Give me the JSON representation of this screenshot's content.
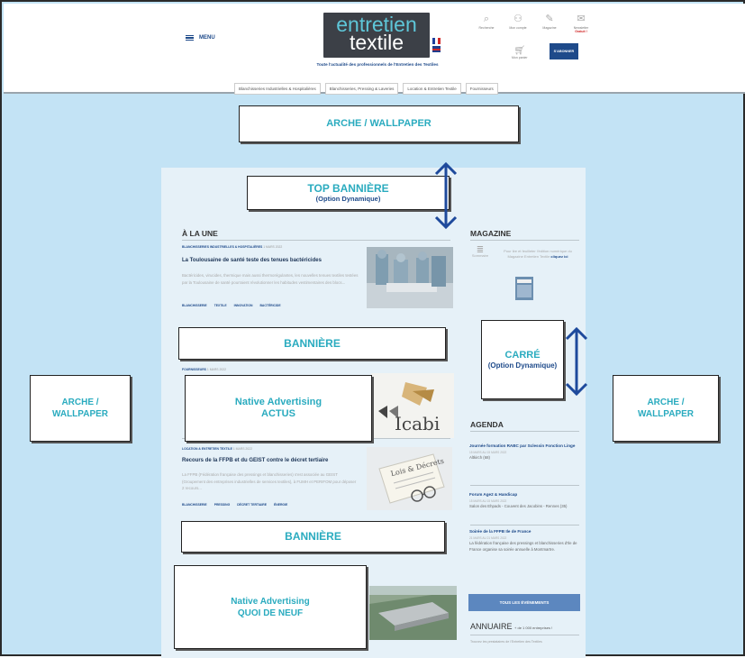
{
  "header": {
    "menu_label": "MENU",
    "logo_line1": "entretien",
    "logo_line2": "textile",
    "tagline": "Toute l'actualité des professionnels de l'Entretien des Textiles",
    "icons": [
      {
        "label": "Recherche",
        "icon": "search-icon"
      },
      {
        "label": "Mon compte",
        "icon": "user-icon"
      },
      {
        "label": "Magazine",
        "icon": "magazine-icon"
      },
      {
        "label": "Newsletter",
        "icon": "newsletter-icon",
        "note": "Gratuit !"
      }
    ],
    "cart_label": "Mon panier",
    "subscribe_label": "S'ABONNER",
    "categories": [
      "Blanchisseries Industrielles & Hospitalières",
      "Blanchisseries, Pressing & Laveries",
      "Location & Entretien Textile",
      "Fournisseurs"
    ]
  },
  "labels": {
    "arche_top": "ARCHE / WALLPAPER",
    "top_banner": "TOP BANNIÈRE",
    "top_banner_sub": "(Option Dynamique)",
    "banner_1": "BANNIÈRE",
    "banner_2": "BANNIÈRE",
    "carre": "CARRÉ",
    "carre_sub": "(Option Dynamique)",
    "native_actus_1": "Native Advertising",
    "native_actus_2": "ACTUS",
    "native_quoi_1": "Native Advertising",
    "native_quoi_2": "QUOI DE NEUF",
    "arche_left": "ARCHE / WALLPAPER",
    "arche_right": "ARCHE / WALLPAPER"
  },
  "main": {
    "une_title": "À LA UNE",
    "article1": {
      "category": "BLANCHISSERIES INDUSTRIELLES & HOSPITALIÈRES",
      "date": "1 MARS 2022",
      "title": "La Toulousaine de santé teste des tenues bactéricides",
      "excerpt": "Bactéricides, virucides, thermique mais aussi thermorégulantes, les nouvelles tenues textiles testées par la Toulousaine de santé pourraient révolutionner les habitudes vestimentaires des blocs...",
      "tags": [
        "BLANCHISSERIE",
        "TEXTILE",
        "INNOVATION",
        "BACTÉRICIDE"
      ]
    },
    "article2": {
      "category": "FOURNISSEURS",
      "date": "1 MARS 2022"
    },
    "article3": {
      "category": "LOCATION & ENTRETIEN TEXTILE",
      "date": "1 MARS 2022",
      "title": "Recours de la FFPB et du GEIST contre le décret tertiaire",
      "excerpt": "La FFPB (Fédération française des pressings et blanchisseries) s'est associée au GEIST (Groupement des entreprises industrielles de services textiles), à FUMH et PERIFOM pour déposer 2 recours...",
      "tags": [
        "BLANCHISSERIE",
        "PRESSING",
        "DÉCRET TERTIAIRE",
        "ÉNERGIE"
      ],
      "image_text": "Lois & Décrets"
    },
    "logo_text": "Icabi"
  },
  "sidebar": {
    "magazine_title": "MAGAZINE",
    "magazine_summary": "Sommaire",
    "magazine_text": "Pour lire et feuilleter l'édition numérique du Magazine Entretien Textile",
    "magazine_link": "cliquez ici",
    "agenda_title": "AGENDA",
    "events": [
      {
        "title": "Journée formation RABC par Sclessin Fonction Linge",
        "date": "15 MARS AU 15 MARS 2022",
        "place": "Altkirch (68)"
      },
      {
        "title": "Forum Age2 & Handicap",
        "date": "15 MARS AU 15 MARS 2022",
        "place": "Salon des Ehpads - Couvent des Jacobins - Rennes (35)"
      },
      {
        "title": "Soirée de la FFPB Ile de France",
        "date": "21 MARS AU 21 MARS 2022",
        "place": "La fédération française des pressings et blanchisseries d'Ile de France organise sa soirée annuelle à Montmartre."
      }
    ],
    "events_button": "TOUS LES ÉVÉNEMENTS",
    "annuaire_title": "ANNUAIRE",
    "annuaire_count": "+ de 1 000 entreprises !",
    "annuaire_text": "Trouvez les prestataires de l'Entretien des Textiles"
  },
  "colors": {
    "background": "#c3e3f5",
    "label_text": "#2aabbf",
    "sub_text": "#1e4a8a",
    "arrow": "#1e4a9c",
    "brand_dark": "#3c4047"
  }
}
